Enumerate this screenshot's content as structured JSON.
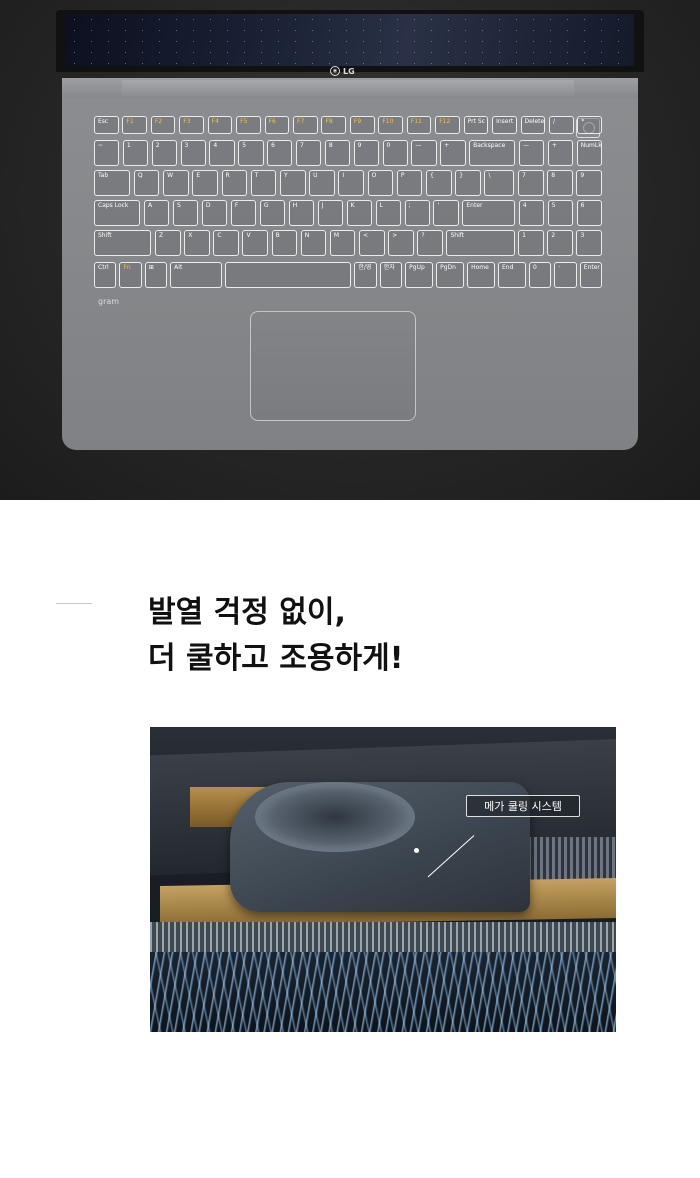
{
  "brand": {
    "logo_text": "LG",
    "model_text": "gram"
  },
  "keyboard": {
    "rows": [
      [
        "Esc",
        "F1",
        "F2",
        "F3",
        "F4",
        "F5",
        "F6",
        "F7",
        "F8",
        "F9",
        "F10",
        "F11",
        "F12",
        "Prt Sc",
        "Insert",
        "Delete",
        "/",
        "*"
      ],
      [
        "~",
        "1",
        "2",
        "3",
        "4",
        "5",
        "6",
        "7",
        "8",
        "9",
        "0",
        "—",
        "+",
        "Backspace",
        "—",
        "+",
        "NumLk"
      ],
      [
        "Tab",
        "Q",
        "W",
        "E",
        "R",
        "T",
        "Y",
        "U",
        "I",
        "O",
        "P",
        "{",
        "}",
        "\\",
        "7",
        "8",
        "9"
      ],
      [
        "Caps Lock",
        "A",
        "S",
        "D",
        "F",
        "G",
        "H",
        "J",
        "K",
        "L",
        ";",
        "'",
        "Enter",
        "4",
        "5",
        "6"
      ],
      [
        "Shift",
        "Z",
        "X",
        "C",
        "V",
        "B",
        "N",
        "M",
        "<",
        ">",
        "?",
        "Shift",
        "1",
        "2",
        "3"
      ],
      [
        "Ctrl",
        "Fn",
        "⊞",
        "Alt",
        "",
        "한/영",
        "한자",
        "PgUp",
        "PgDn",
        "Home",
        "End",
        "0",
        "·",
        "Enter"
      ]
    ]
  },
  "headline": {
    "line1": "발열 걱정 없이,",
    "line2": "더 쿨하고 조용하게!"
  },
  "cooling": {
    "callout_label": "메가 쿨링 시스템"
  },
  "colors": {
    "fn_accent": "#f6c23e",
    "deck": "#8b8d90"
  }
}
